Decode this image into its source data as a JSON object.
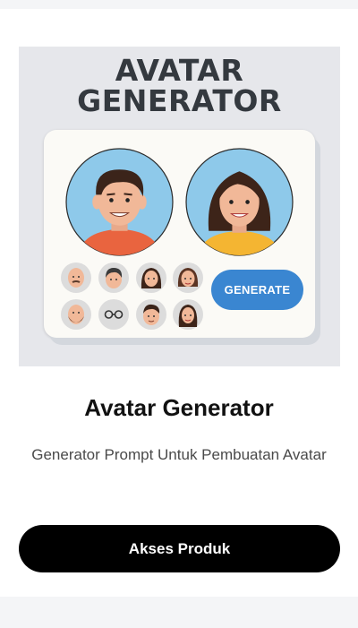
{
  "hero": {
    "title_line1": "AVATAR",
    "title_line2": "GENERATOR",
    "generate_label": "GENERATE"
  },
  "product": {
    "title": "Avatar Generator",
    "description": "Generator Prompt Untuk Pembuatan Avatar"
  },
  "cta": {
    "label": "Akses Produk"
  },
  "colors": {
    "avatar_bg": "#8ec9ea",
    "generate_button": "#3a86d1",
    "cta_button": "#000000"
  }
}
